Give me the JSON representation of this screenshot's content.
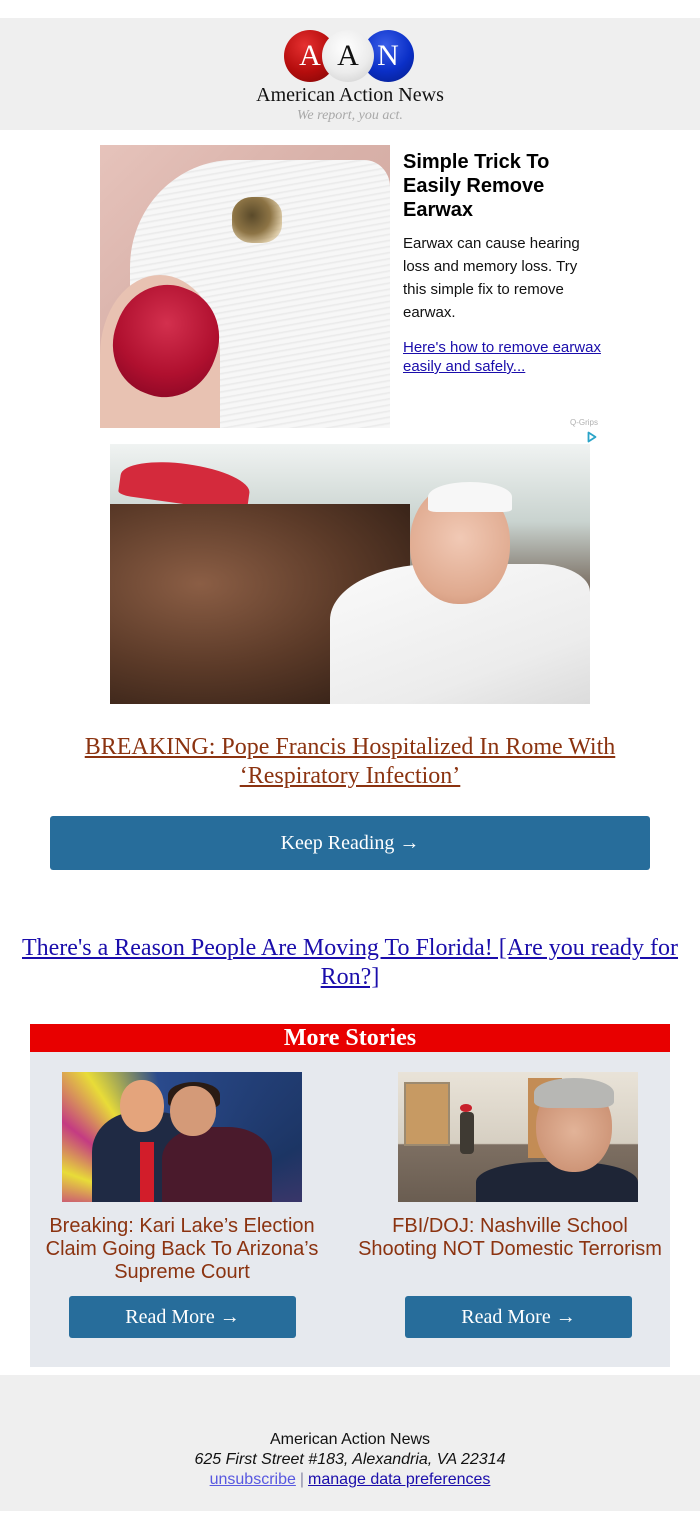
{
  "header": {
    "logo_letters": [
      "A",
      "A",
      "N"
    ],
    "brand_name": "American Action News",
    "tagline": "We report, you act.",
    "colors": {
      "red": "#b50d0d",
      "white": "#ececec",
      "blue": "#0a2fc7"
    }
  },
  "ad": {
    "image_alt": "Tissue with earwax held by a hand with red glitter nail polish",
    "title": "Simple Trick To Easily Remove Earwax",
    "description": "Earwax can cause hearing loss and memory loss. Try this simple fix to remove earwax.",
    "link_text": "Here's how to remove earwax easily and safely...",
    "sponsor": "Q-Grips",
    "adchoices_icon": "adchoices-triangle-icon"
  },
  "main_story": {
    "image_alt": "Pope Francis greeting a crowd",
    "headline": "BREAKING: Pope Francis Hospitalized In Rome With ‘Respiratory Infection’",
    "button_label": "Keep Reading →"
  },
  "promo": {
    "link_text": "There's a Reason People Are Moving To Florida! [Are you ready for Ron?]"
  },
  "more_stories": {
    "heading": "More Stories",
    "items": [
      {
        "image_alt": "Trump and Kari Lake in front of Arizona flag",
        "title": "Breaking: Kari Lake’s Election Claim Going Back To Arizona’s Supreme Court",
        "button_label": "Read More →"
      },
      {
        "image_alt": "Merrick Garland with Nashville school hallway",
        "title": "FBI/DOJ: Nashville School Shooting NOT Domestic Terrorism",
        "button_label": "Read More →"
      }
    ]
  },
  "footer": {
    "name": "American Action News",
    "address": "625 First Street #183, Alexandria, VA 22314",
    "unsubscribe": "unsubscribe",
    "separator": "|",
    "manage_prefs": "manage data preferences"
  },
  "theme": {
    "button_blue": "#276d9b",
    "headline_brown": "#8b3310",
    "link_blue": "#1a0dab",
    "more_stories_red": "#e80000",
    "panel_bg": "#e6e9ee",
    "band_gray": "#efefef"
  }
}
